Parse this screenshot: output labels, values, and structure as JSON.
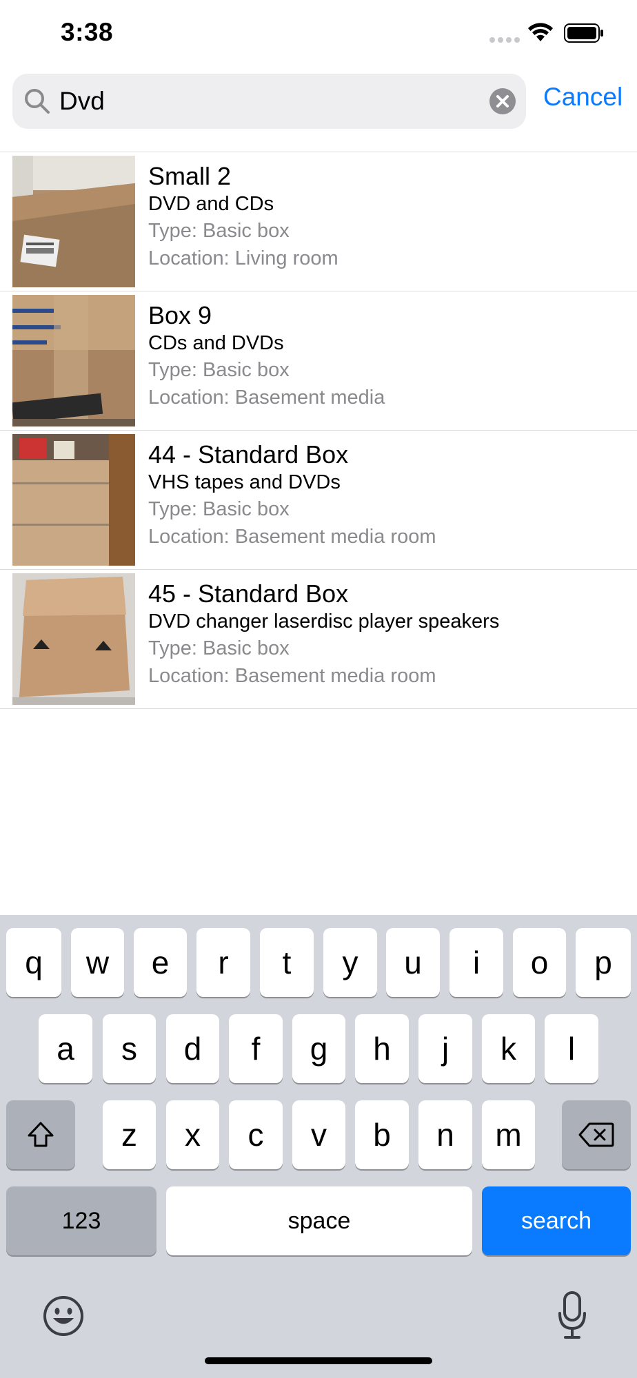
{
  "status_bar": {
    "time": "3:38"
  },
  "search": {
    "value": "Dvd",
    "cancel_label": "Cancel"
  },
  "results": [
    {
      "title": "Small 2",
      "description": "DVD and CDs",
      "type": "Type: Basic box",
      "location": "Location: Living room"
    },
    {
      "title": "Box 9",
      "description": "CDs and DVDs",
      "type": "Type: Basic box",
      "location": "Location: Basement media"
    },
    {
      "title": "44 - Standard Box",
      "description": "VHS tapes and DVDs",
      "type": "Type: Basic box",
      "location": "Location: Basement media room"
    },
    {
      "title": "45 - Standard Box",
      "description": "DVD changer laserdisc player speakers",
      "type": "Type: Basic box",
      "location": "Location: Basement media room"
    }
  ],
  "keyboard": {
    "row1": [
      "q",
      "w",
      "e",
      "r",
      "t",
      "y",
      "u",
      "i",
      "o",
      "p"
    ],
    "row2": [
      "a",
      "s",
      "d",
      "f",
      "g",
      "h",
      "j",
      "k",
      "l"
    ],
    "row3": [
      "z",
      "x",
      "c",
      "v",
      "b",
      "n",
      "m"
    ],
    "numbers_label": "123",
    "space_label": "space",
    "search_label": "search"
  },
  "colors": {
    "accent": "#0a7aff",
    "secondary_text": "#8a8a8e",
    "keyboard_bg": "#d2d5db"
  }
}
